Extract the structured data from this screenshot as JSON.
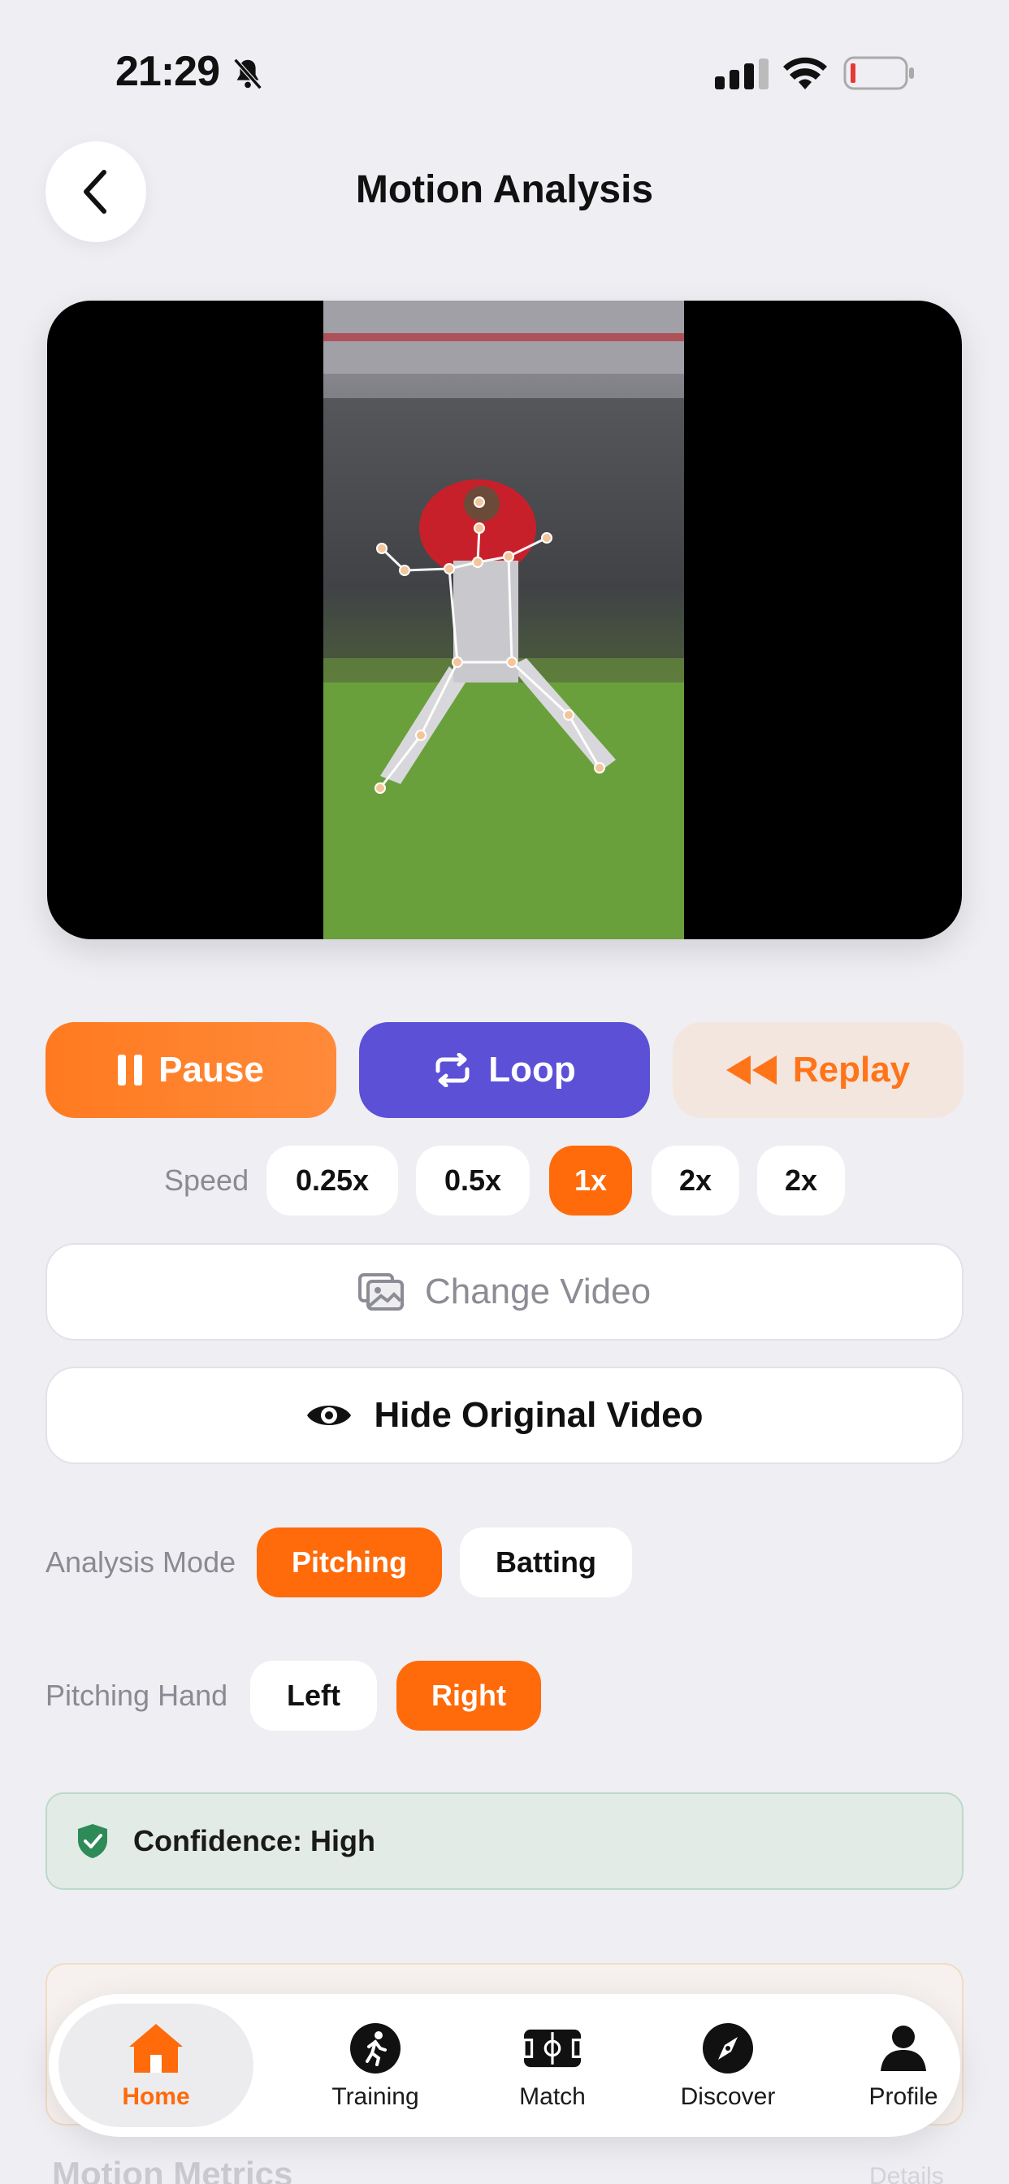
{
  "status_bar": {
    "time": "21:29"
  },
  "header": {
    "title": "Motion Analysis"
  },
  "controls": {
    "pause_label": "Pause",
    "loop_label": "Loop",
    "replay_label": "Replay"
  },
  "speed": {
    "label": "Speed",
    "options": [
      "0.25x",
      "0.5x",
      "1x",
      "2x",
      "2x"
    ],
    "selected": "1x"
  },
  "actions": {
    "change_video": "Change Video",
    "hide_original": "Hide Original Video"
  },
  "analysis_mode": {
    "label": "Analysis Mode",
    "options": [
      "Pitching",
      "Batting"
    ],
    "selected": "Pitching"
  },
  "pitching_hand": {
    "label": "Pitching Hand",
    "options": [
      "Left",
      "Right"
    ],
    "selected": "Right"
  },
  "confidence": {
    "text": "Confidence: High"
  },
  "peek": {
    "metrics_title": "Motion Metrics",
    "details": "Details"
  },
  "tabbar": {
    "items": [
      {
        "label": "Home",
        "icon": "home-icon"
      },
      {
        "label": "Training",
        "icon": "running-icon"
      },
      {
        "label": "Match",
        "icon": "field-icon"
      },
      {
        "label": "Discover",
        "icon": "compass-icon"
      },
      {
        "label": "Profile",
        "icon": "person-icon"
      }
    ],
    "active": "Home"
  },
  "colors": {
    "accent_orange": "#ff6a0a",
    "loop_purple": "#5b50d6",
    "replay_bg": "#f3e6de",
    "confidence_green": "#2e8b57"
  }
}
